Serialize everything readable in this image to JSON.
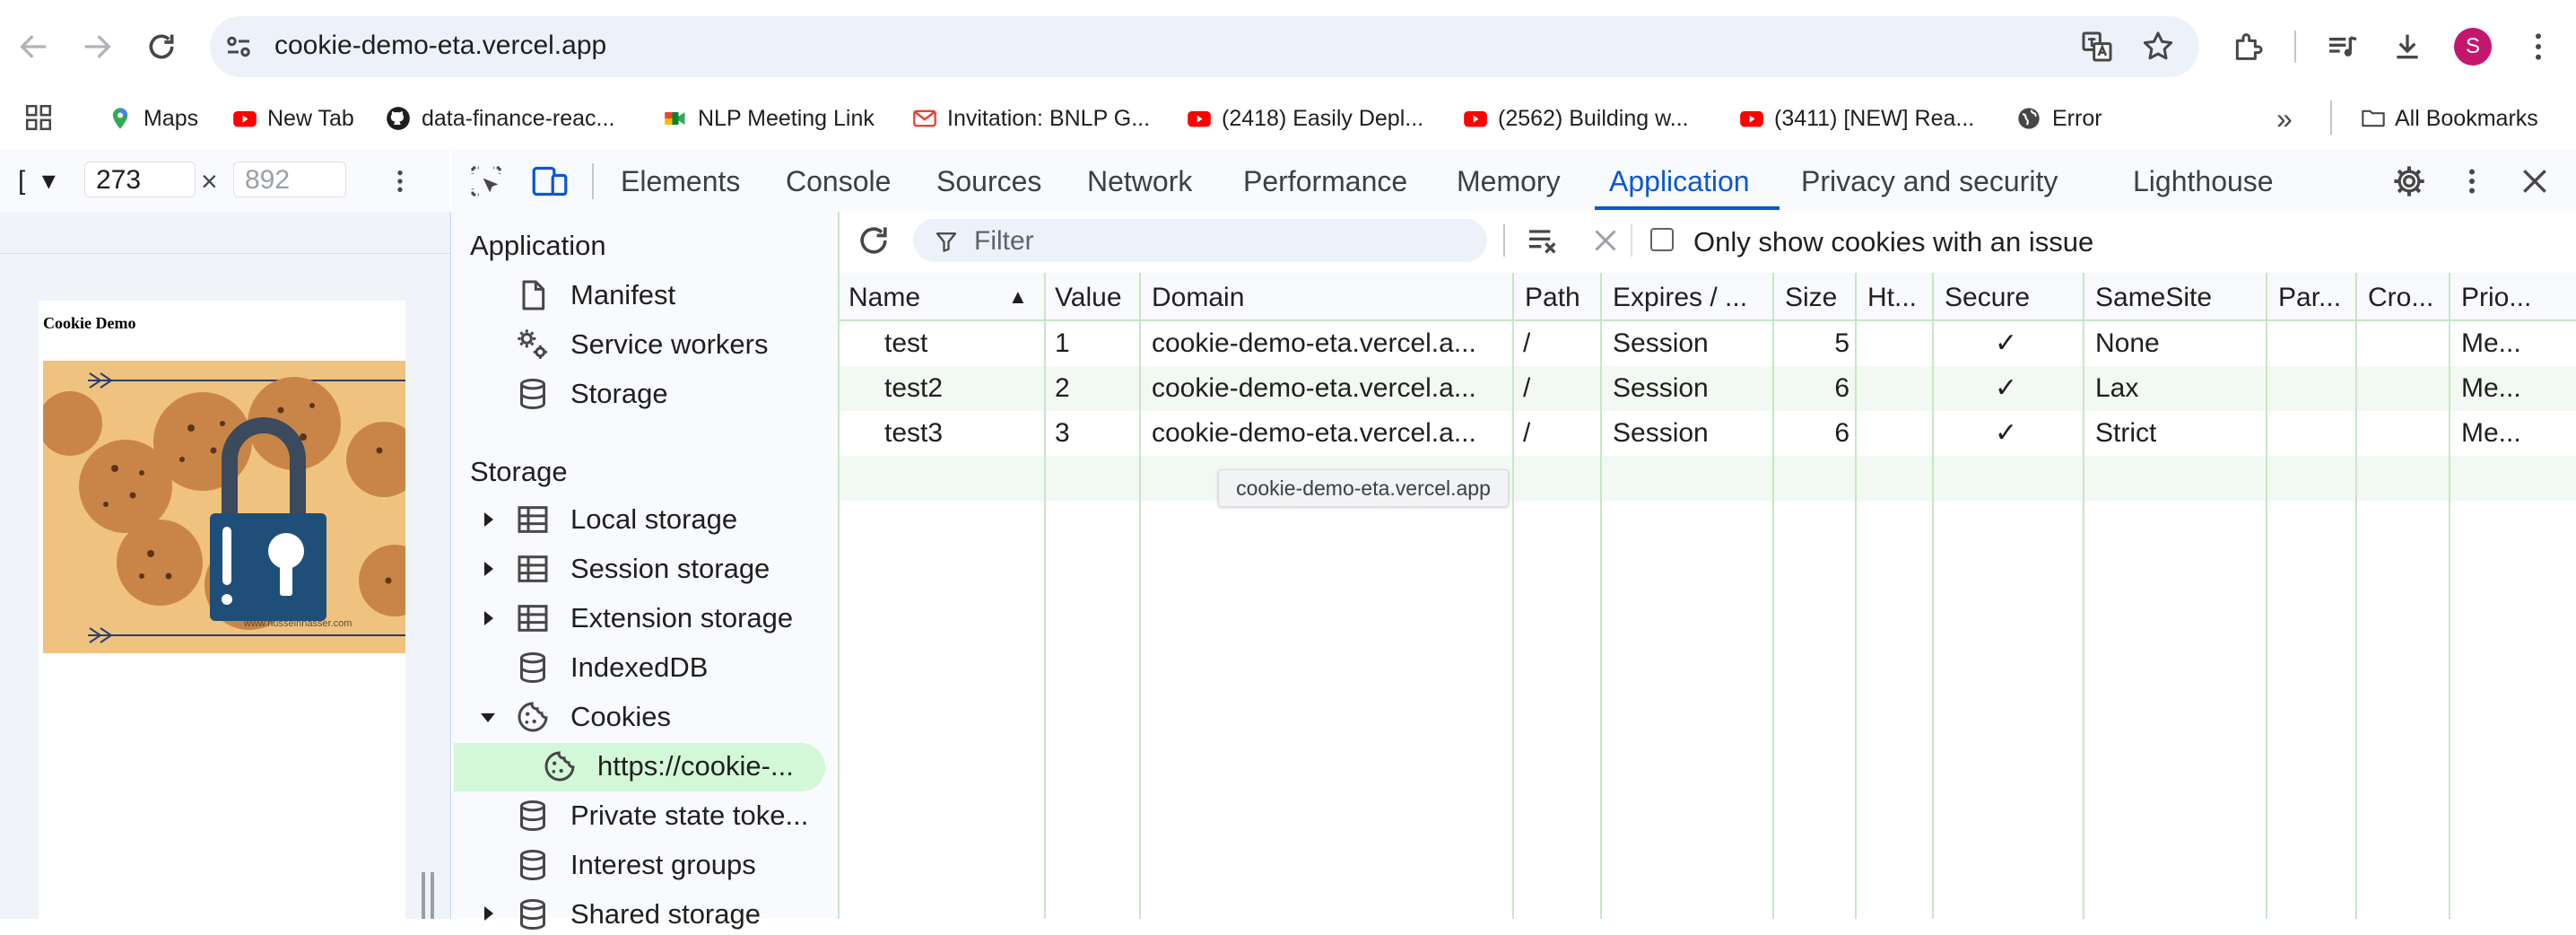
{
  "browser": {
    "url": "cookie-demo-eta.vercel.app",
    "profile_initial": "S",
    "accent_color": "#0b57d0",
    "profile_color": "#c5166e"
  },
  "bookmarks": {
    "items": [
      {
        "label": "Maps",
        "icon": "maps-pin-icon"
      },
      {
        "label": "New Tab",
        "icon": "youtube-icon"
      },
      {
        "label": "data-finance-reac...",
        "icon": "github-icon"
      },
      {
        "label": "NLP Meeting Link",
        "icon": "google-meet-icon"
      },
      {
        "label": "Invitation: BNLP G...",
        "icon": "gmail-icon"
      },
      {
        "label": "(2418) Easily Depl...",
        "icon": "youtube-icon"
      },
      {
        "label": "(2562) Building w...",
        "icon": "youtube-icon"
      },
      {
        "label": "(3411) [NEW] Rea...",
        "icon": "youtube-icon"
      },
      {
        "label": "Error",
        "icon": "globe-icon"
      }
    ],
    "overflow": "»",
    "all_bookmarks": "All Bookmarks"
  },
  "device_toolbar": {
    "width": "273",
    "height": "892",
    "separator": "×",
    "mode_glyph": "[",
    "dropdown_glyph": "▾"
  },
  "page_preview": {
    "title": "Cookie Demo",
    "watermark": "www.husseinnasser.com"
  },
  "devtools": {
    "tabs": [
      {
        "label": "Elements",
        "active": false
      },
      {
        "label": "Console",
        "active": false
      },
      {
        "label": "Sources",
        "active": false
      },
      {
        "label": "Network",
        "active": false
      },
      {
        "label": "Performance",
        "active": false
      },
      {
        "label": "Memory",
        "active": false
      },
      {
        "label": "Application",
        "active": true
      },
      {
        "label": "Privacy and security",
        "active": false
      },
      {
        "label": "Lighthouse",
        "active": false
      }
    ]
  },
  "sidebar": {
    "application_header": "Application",
    "application_items": [
      {
        "label": "Manifest",
        "icon": "document-icon"
      },
      {
        "label": "Service workers",
        "icon": "gears-icon"
      },
      {
        "label": "Storage",
        "icon": "database-icon"
      }
    ],
    "storage_header": "Storage",
    "storage_items": [
      {
        "label": "Local storage",
        "icon": "table-icon",
        "expander": "collapsed"
      },
      {
        "label": "Session storage",
        "icon": "table-icon",
        "expander": "collapsed"
      },
      {
        "label": "Extension storage",
        "icon": "table-icon",
        "expander": "collapsed"
      },
      {
        "label": "IndexedDB",
        "icon": "database-icon",
        "expander": "none"
      },
      {
        "label": "Cookies",
        "icon": "cookie-icon",
        "expander": "expanded"
      },
      {
        "label": "https://cookie-...",
        "icon": "cookie-icon",
        "expander": "none",
        "selected": true
      },
      {
        "label": "Private state toke...",
        "icon": "database-icon",
        "expander": "none"
      },
      {
        "label": "Interest groups",
        "icon": "database-icon",
        "expander": "none"
      },
      {
        "label": "Shared storage",
        "icon": "database-icon",
        "expander": "collapsed"
      }
    ]
  },
  "cookies_panel": {
    "filter_placeholder": "Filter",
    "only_issue_label": "Only show cookies with an issue",
    "only_issue_checked": false,
    "columns": [
      "Name",
      "Value",
      "Domain",
      "Path",
      "Expires / ...",
      "Size",
      "Ht...",
      "Secure",
      "SameSite",
      "Par...",
      "Cro...",
      "Prio..."
    ],
    "sort_indicator": "▲",
    "rows": [
      {
        "name": "test",
        "value": "1",
        "domain": "cookie-demo-eta.vercel.a...",
        "path": "/",
        "expires": "Session",
        "size": "5",
        "http": "",
        "secure": "✓",
        "samesite": "None",
        "partition": "",
        "cross": "",
        "priority": "Me..."
      },
      {
        "name": "test2",
        "value": "2",
        "domain": "cookie-demo-eta.vercel.a...",
        "path": "/",
        "expires": "Session",
        "size": "6",
        "http": "",
        "secure": "✓",
        "samesite": "Lax",
        "partition": "",
        "cross": "",
        "priority": "Me..."
      },
      {
        "name": "test3",
        "value": "3",
        "domain": "cookie-demo-eta.vercel.a...",
        "path": "/",
        "expires": "Session",
        "size": "6",
        "http": "",
        "secure": "✓",
        "samesite": "Strict",
        "partition": "",
        "cross": "",
        "priority": "Me..."
      }
    ],
    "tooltip": "cookie-demo-eta.vercel.app"
  }
}
